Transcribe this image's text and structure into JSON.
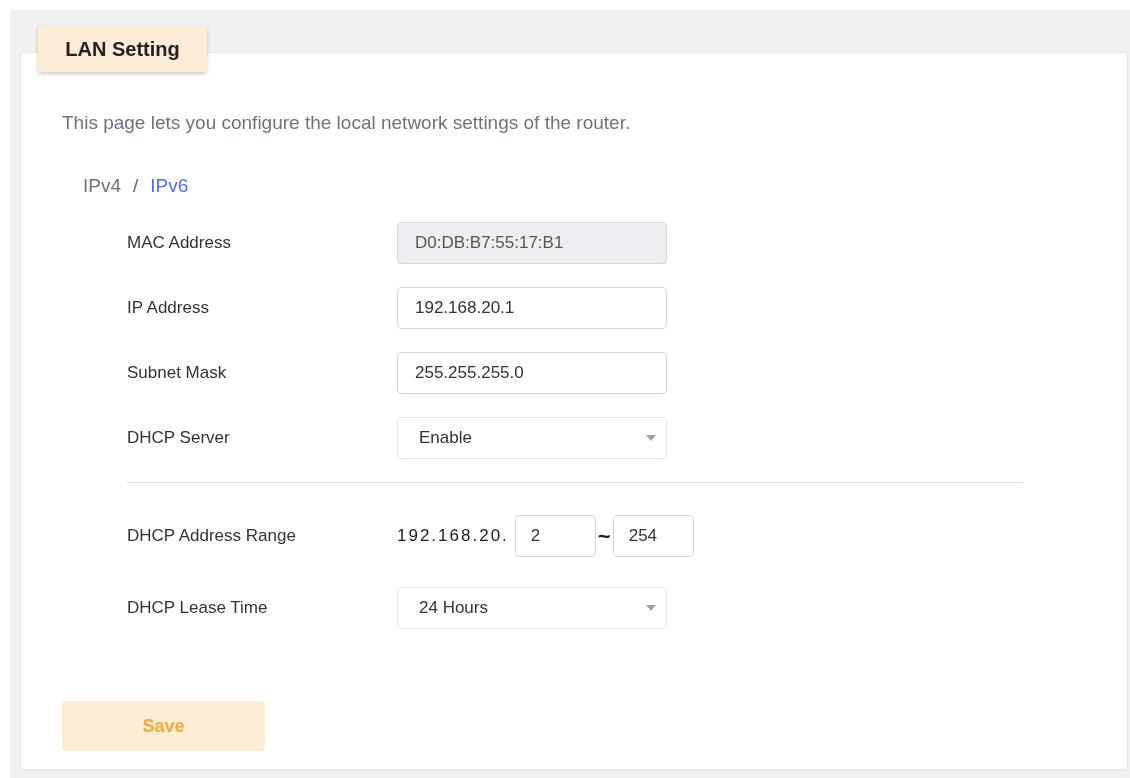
{
  "panel": {
    "title": "LAN Setting"
  },
  "description": "This page lets you configure the local network settings of the router.",
  "ip_tabs": [
    {
      "label": "IPv4",
      "selected": false
    },
    {
      "label": "IPv6",
      "selected": true
    }
  ],
  "separator": "/",
  "fields": [
    {
      "kind": "readonly",
      "label": "MAC Address",
      "value": "D0:DB:B7:55:17:B1"
    },
    {
      "kind": "text",
      "label": "IP Address",
      "value": "192.168.20.1"
    },
    {
      "kind": "text",
      "label": "Subnet Mask",
      "value": "255.255.255.0"
    },
    {
      "kind": "select",
      "label": "DHCP Server",
      "value": "Enable"
    },
    {
      "kind": "divider"
    },
    {
      "kind": "range",
      "label": "DHCP Address Range",
      "prefix": "192.168.20.",
      "start": "2",
      "tilde": "~",
      "end": "254"
    },
    {
      "kind": "select",
      "label": "DHCP Lease Time",
      "value": "24 Hours"
    }
  ],
  "save_button": "Save"
}
